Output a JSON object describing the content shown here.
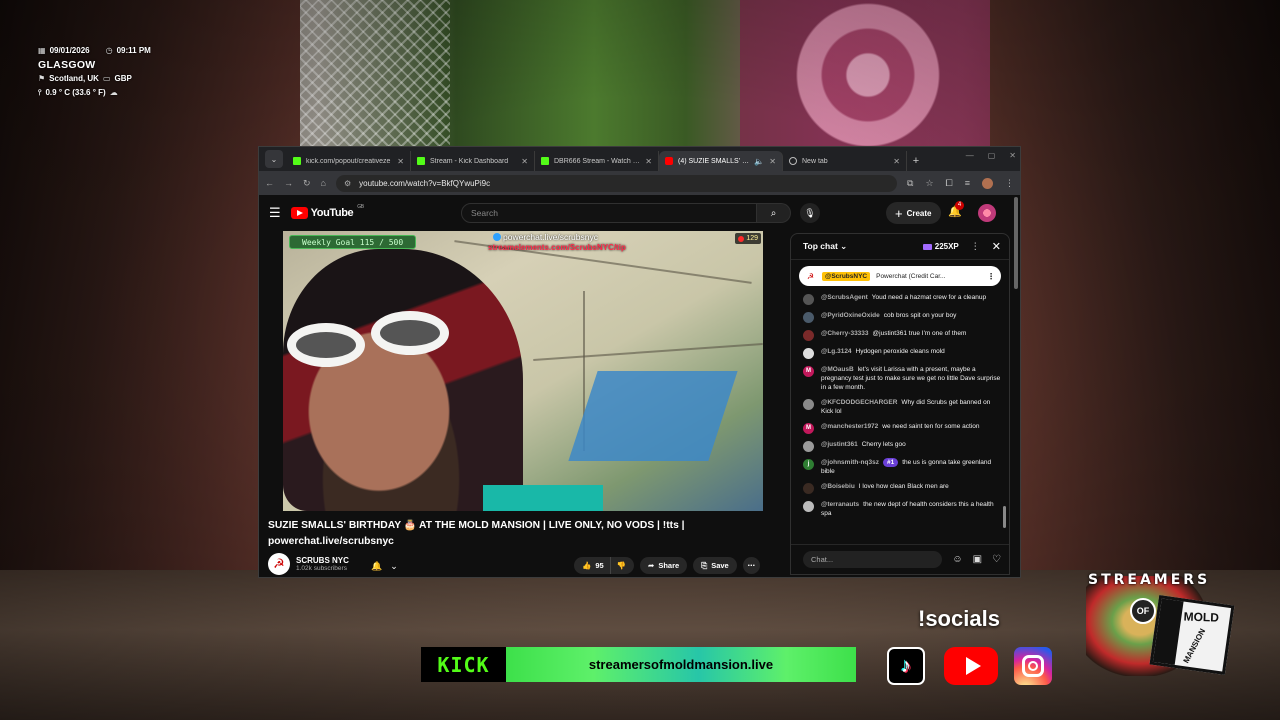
{
  "overlay_info": {
    "date": "09/01/2026",
    "time": "09:11 PM",
    "city": "GLASGOW",
    "region": "Scotland, UK",
    "currency": "GBP",
    "temperature": "0.9 ° C (33.6 ° F)"
  },
  "browser": {
    "tabs": [
      {
        "title": "kick.com/popout/creativeze",
        "icon": "kick-favicon",
        "active": false
      },
      {
        "title": "Stream - Kick Dashboard",
        "icon": "kick-favicon",
        "active": false
      },
      {
        "title": "DBR666 Stream - Watch Live",
        "icon": "kick-favicon",
        "active": false
      },
      {
        "title": "(4) SUZIE SMALLS' BIRTHD",
        "icon": "youtube-favicon",
        "active": true
      },
      {
        "title": "New tab",
        "icon": "globe-favicon",
        "active": false
      }
    ],
    "url": "youtube.com/watch?v=BkfQYwuPi9c"
  },
  "youtube": {
    "logo_text": "YouTube",
    "logo_sup": "GB",
    "search_placeholder": "Search",
    "create_label": "Create",
    "notification_count": "4",
    "video": {
      "weekly_goal": "Weekly Goal 115 / 500",
      "powerchat_text": "powerchat.live/scrubsnyc",
      "streamelements_text": "streamelements.com/ScrubsNYC/tip",
      "viewer_count": "129",
      "title": "SUZIE SMALLS' BIRTHDAY 🎂 AT THE MOLD MANSION | LIVE ONLY, NO VODS | !tts | powerchat.live/scrubsnyc"
    },
    "channel": {
      "name": "SCRUBS NYC",
      "subscribers": "1.02k subscribers",
      "avatar_glyph": "☭"
    },
    "actions": {
      "like_count": "95",
      "share_label": "Share",
      "save_label": "Save"
    },
    "chat": {
      "mode_label": "Top chat",
      "xp": "225XP",
      "pinned": {
        "user": "@ScrubsNYC",
        "message": "Powerchat (Credit Car..."
      },
      "messages": [
        {
          "user": "@ScrubsAgent",
          "text": "Youd need a hazmat crew for a cleanup",
          "avatar": "",
          "color": "#555555"
        },
        {
          "user": "@PyridOxineOxide",
          "text": "cob bros spit on your boy",
          "avatar": "",
          "color": "#4a5a6a"
        },
        {
          "user": "@Cherry-33333",
          "text": "@justint361 true I'm one of them",
          "avatar": "",
          "color": "#7a2a2a"
        },
        {
          "user": "@Lg.3124",
          "text": "Hydogen peroxide cleans mold",
          "avatar": "",
          "color": "#dddddd"
        },
        {
          "user": "@MOausB",
          "text": "let's visit Larissa with a present, maybe a pregnancy test just to make sure we get no little Dave surprise in a few month.",
          "avatar": "M",
          "color": "#c2185b"
        },
        {
          "user": "@KFCDODGECHARGER",
          "text": "Why did Scrubs get banned on Kick lol",
          "avatar": "",
          "color": "#8a8a8a"
        },
        {
          "user": "@manchester1972",
          "text": "we need saint ten for some action",
          "avatar": "M",
          "color": "#c2185b"
        },
        {
          "user": "@justint361",
          "text": "Cherry lets goo",
          "avatar": "",
          "color": "#9a9a9a"
        },
        {
          "user": "@johnsmith-nq3sz",
          "badge": "#1",
          "text": "the us is gonna take greenland bible",
          "avatar": "j",
          "color": "#2e7d32"
        },
        {
          "user": "@Boisebiu",
          "text": "I love how clean Black men are",
          "avatar": "",
          "color": "#3a2a22"
        },
        {
          "user": "@terranauts",
          "text": "the new dept of health considers this a health spa",
          "avatar": "",
          "color": "#bbbbbb"
        }
      ],
      "input_placeholder": "Chat..."
    }
  },
  "stream_overlay": {
    "kick_logo": "KICK",
    "website": "streamersofmoldmansion.live",
    "socials_label": "!socials",
    "brand_top": "STREAMERS",
    "brand_of": "OF",
    "brand_mold": "MOLD",
    "brand_mansion": "MANSION"
  },
  "colors": {
    "kick_green": "#53fc18",
    "youtube_red": "#ff0000",
    "chat_badge": "#6a3fd6"
  }
}
